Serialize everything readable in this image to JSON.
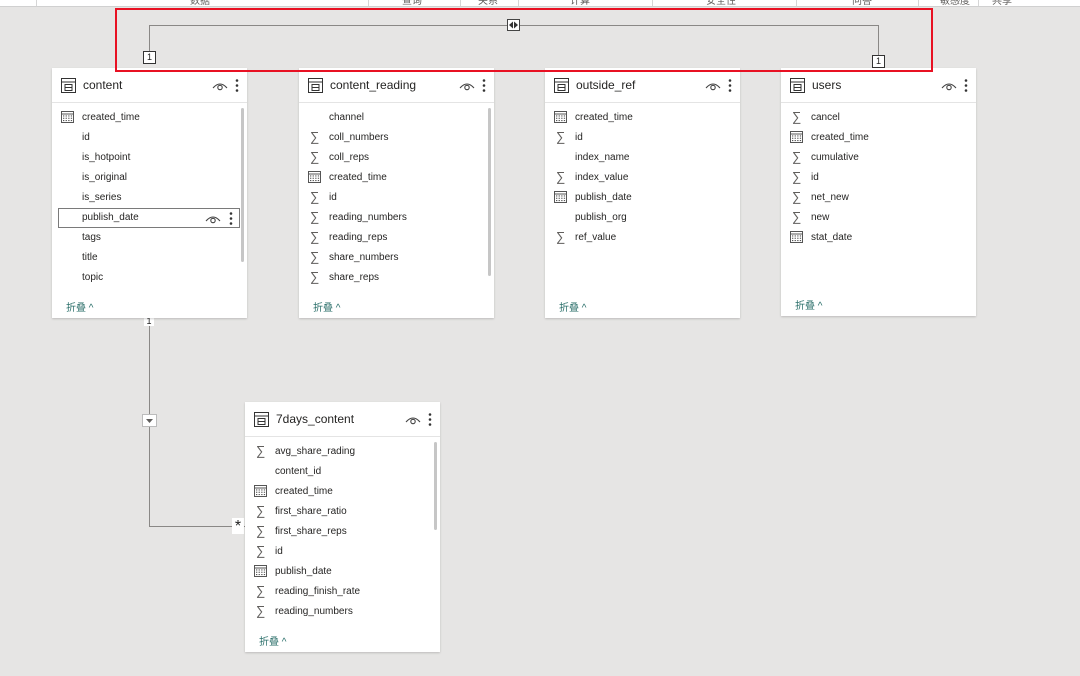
{
  "topbar": {
    "items": [
      "数据",
      "查询",
      "关系",
      "计算",
      "安全性",
      "问答",
      "敏感度",
      "共享"
    ]
  },
  "common": {
    "collapse_label": "折叠 ^"
  },
  "tables": [
    {
      "name": "content",
      "fields": [
        {
          "name": "created_time",
          "icon": "calendar-icon"
        },
        {
          "name": "id",
          "icon": "none"
        },
        {
          "name": "is_hotpoint",
          "icon": "none"
        },
        {
          "name": "is_original",
          "icon": "none"
        },
        {
          "name": "is_series",
          "icon": "none"
        },
        {
          "name": "publish_date",
          "icon": "none",
          "selected": true
        },
        {
          "name": "tags",
          "icon": "none"
        },
        {
          "name": "title",
          "icon": "none"
        },
        {
          "name": "topic",
          "icon": "none"
        }
      ]
    },
    {
      "name": "content_reading",
      "fields": [
        {
          "name": "channel",
          "icon": "none"
        },
        {
          "name": "coll_numbers",
          "icon": "sigma-icon"
        },
        {
          "name": "coll_reps",
          "icon": "sigma-icon"
        },
        {
          "name": "created_time",
          "icon": "calendar-icon"
        },
        {
          "name": "id",
          "icon": "sigma-icon"
        },
        {
          "name": "reading_numbers",
          "icon": "sigma-icon"
        },
        {
          "name": "reading_reps",
          "icon": "sigma-icon"
        },
        {
          "name": "share_numbers",
          "icon": "sigma-icon"
        },
        {
          "name": "share_reps",
          "icon": "sigma-icon"
        }
      ]
    },
    {
      "name": "outside_ref",
      "fields": [
        {
          "name": "created_time",
          "icon": "calendar-icon"
        },
        {
          "name": "id",
          "icon": "sigma-icon"
        },
        {
          "name": "index_name",
          "icon": "none"
        },
        {
          "name": "index_value",
          "icon": "sigma-icon"
        },
        {
          "name": "publish_date",
          "icon": "calendar-icon"
        },
        {
          "name": "publish_org",
          "icon": "none"
        },
        {
          "name": "ref_value",
          "icon": "sigma-icon"
        }
      ]
    },
    {
      "name": "users",
      "fields": [
        {
          "name": "cancel",
          "icon": "sigma-icon"
        },
        {
          "name": "created_time",
          "icon": "calendar-icon"
        },
        {
          "name": "cumulative",
          "icon": "sigma-icon"
        },
        {
          "name": "id",
          "icon": "sigma-icon"
        },
        {
          "name": "net_new",
          "icon": "sigma-icon"
        },
        {
          "name": "new",
          "icon": "sigma-icon"
        },
        {
          "name": "stat_date",
          "icon": "calendar-icon"
        }
      ]
    },
    {
      "name": "7days_content",
      "fields": [
        {
          "name": "avg_share_rading",
          "icon": "sigma-icon"
        },
        {
          "name": "content_id",
          "icon": "none"
        },
        {
          "name": "created_time",
          "icon": "calendar-icon"
        },
        {
          "name": "first_share_ratio",
          "icon": "sigma-icon"
        },
        {
          "name": "first_share_reps",
          "icon": "sigma-icon"
        },
        {
          "name": "id",
          "icon": "sigma-icon"
        },
        {
          "name": "publish_date",
          "icon": "calendar-icon"
        },
        {
          "name": "reading_finish_rate",
          "icon": "sigma-icon"
        },
        {
          "name": "reading_numbers",
          "icon": "sigma-icon"
        }
      ]
    }
  ],
  "relationships": {
    "content_users": {
      "from_cardinality": "1",
      "to_cardinality": "1"
    },
    "content_7days": {
      "from_cardinality": "1",
      "to_cardinality": "*"
    }
  },
  "colors": {
    "highlight": "#e81123",
    "collapse_text": "#2b6f6a",
    "canvas": "#e6e5e4"
  }
}
